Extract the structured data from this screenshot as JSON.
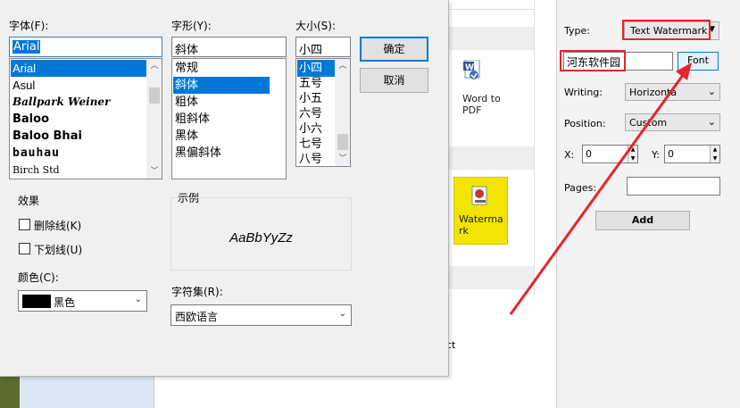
{
  "font_dialog": {
    "font_label": "字体(F):",
    "font_value": "Arial",
    "font_list": [
      "Arial",
      "Asul",
      "Ballpark Weiner",
      "Baloo",
      "Baloo Bhai",
      "bauhau",
      "Birch Std"
    ],
    "style_label": "字形(Y):",
    "style_value": "斜体",
    "style_list": [
      "常规",
      "斜体",
      "粗体",
      "粗斜体",
      "黑体",
      "黑偏斜体"
    ],
    "size_label": "大小(S):",
    "size_value": "小四",
    "size_list": [
      "小四",
      "五号",
      "小五",
      "六号",
      "小六",
      "七号",
      "八号"
    ],
    "ok_button": "确定",
    "cancel_button": "取消",
    "effects_label": "效果",
    "strikeout_label": "删除线(K)",
    "underline_label": "下划线(U)",
    "color_label": "颜色(C):",
    "color_value": "黑色",
    "sample_label": "示例",
    "sample_text": "AaBbYyZz",
    "charset_label": "字符集(R):",
    "charset_value": "西欧语言"
  },
  "background": {
    "word_to_pdf_label": "Word to PDF",
    "watermark_label": "Watermark",
    "partial_text": "ct"
  },
  "right_panel": {
    "type_label": "Type:",
    "type_value": "Text Watermark",
    "text_value": "河东软件园",
    "font_button": "Font",
    "writing_label": "Writing:",
    "writing_value": "Horizonta",
    "position_label": "Position:",
    "position_value": "Custom",
    "x_label": "X:",
    "x_value": "0",
    "y_label": "Y:",
    "y_value": "0",
    "pages_label": "Pages:",
    "pages_value": "",
    "add_button": "Add"
  },
  "colors": {
    "selection": "#0078d7",
    "annotation_red": "#e4252b",
    "watermark_tile": "#f2e400"
  }
}
